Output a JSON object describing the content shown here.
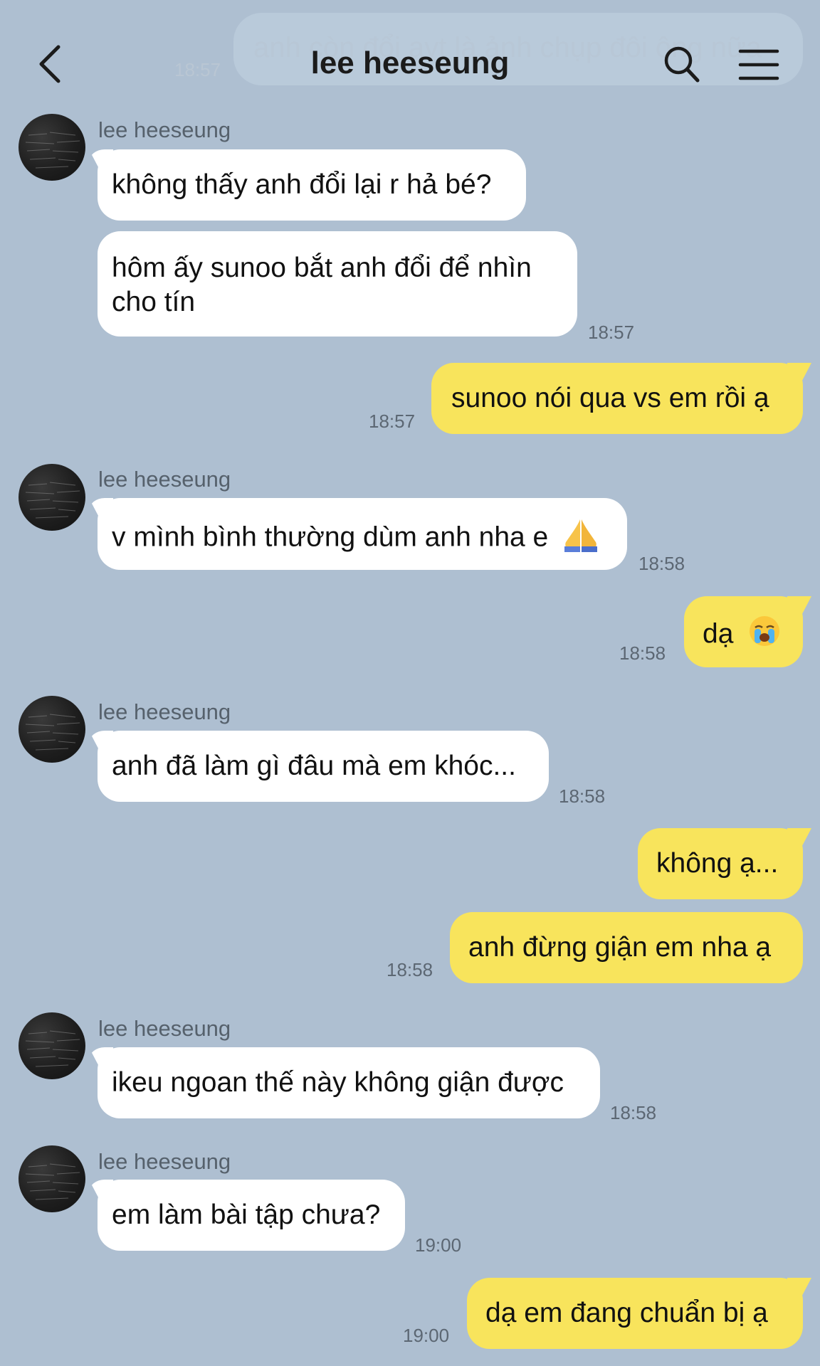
{
  "header": {
    "title": "lee heeseung",
    "ghost_message": "anh còn đổi avt là ảnh chụp đôi ông nữa",
    "ghost_time": "18:57",
    "back_icon": "chevron-left-icon",
    "search_icon": "search-icon",
    "menu_icon": "hamburger-menu-icon"
  },
  "messages": [
    {
      "side": "in",
      "sender": "lee heeseung",
      "text": "không thấy anh đổi lại r hả bé?"
    },
    {
      "side": "in",
      "text": "hôm ấy sunoo bắt anh đổi để nhìn\ncho tín",
      "time": "18:57"
    },
    {
      "side": "out",
      "text": "sunoo nói qua vs em rồi ạ",
      "time": "18:57"
    },
    {
      "side": "in",
      "sender": "lee heeseung",
      "text": "v mình bình thường dùm anh nha e",
      "emoji": "🙏",
      "time": "18:58"
    },
    {
      "side": "out",
      "text": "dạ",
      "emoji": "😭",
      "time": "18:58"
    },
    {
      "side": "in",
      "sender": "lee heeseung",
      "text": "anh đã làm gì đâu mà em khóc...",
      "time": "18:58"
    },
    {
      "side": "out",
      "text": "không ạ..."
    },
    {
      "side": "out",
      "text": "anh đừng giận em nha ạ",
      "time": "18:58"
    },
    {
      "side": "in",
      "sender": "lee heeseung",
      "text": "ikeu ngoan thế này không giận được",
      "time": "18:58"
    },
    {
      "side": "in",
      "sender": "lee heeseung",
      "text": "em làm bài tập chưa?",
      "time": "19:00"
    },
    {
      "side": "out",
      "text": "dạ em đang chuẩn bị ạ",
      "time": "19:00"
    }
  ],
  "colors": {
    "background": "#aebfd1",
    "incoming": "#ffffff",
    "outgoing": "#f8e45c"
  }
}
